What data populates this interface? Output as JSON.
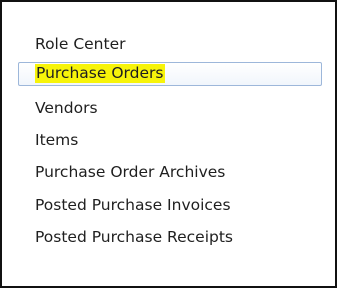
{
  "navigation": {
    "selected_index": 1,
    "highlight_color": "#f7f40a",
    "items": [
      {
        "label": "Role Center"
      },
      {
        "label": "Purchase Orders"
      },
      {
        "label": "Vendors"
      },
      {
        "label": "Items"
      },
      {
        "label": "Purchase Order Archives"
      },
      {
        "label": "Posted Purchase Invoices"
      },
      {
        "label": "Posted Purchase Receipts"
      }
    ]
  }
}
